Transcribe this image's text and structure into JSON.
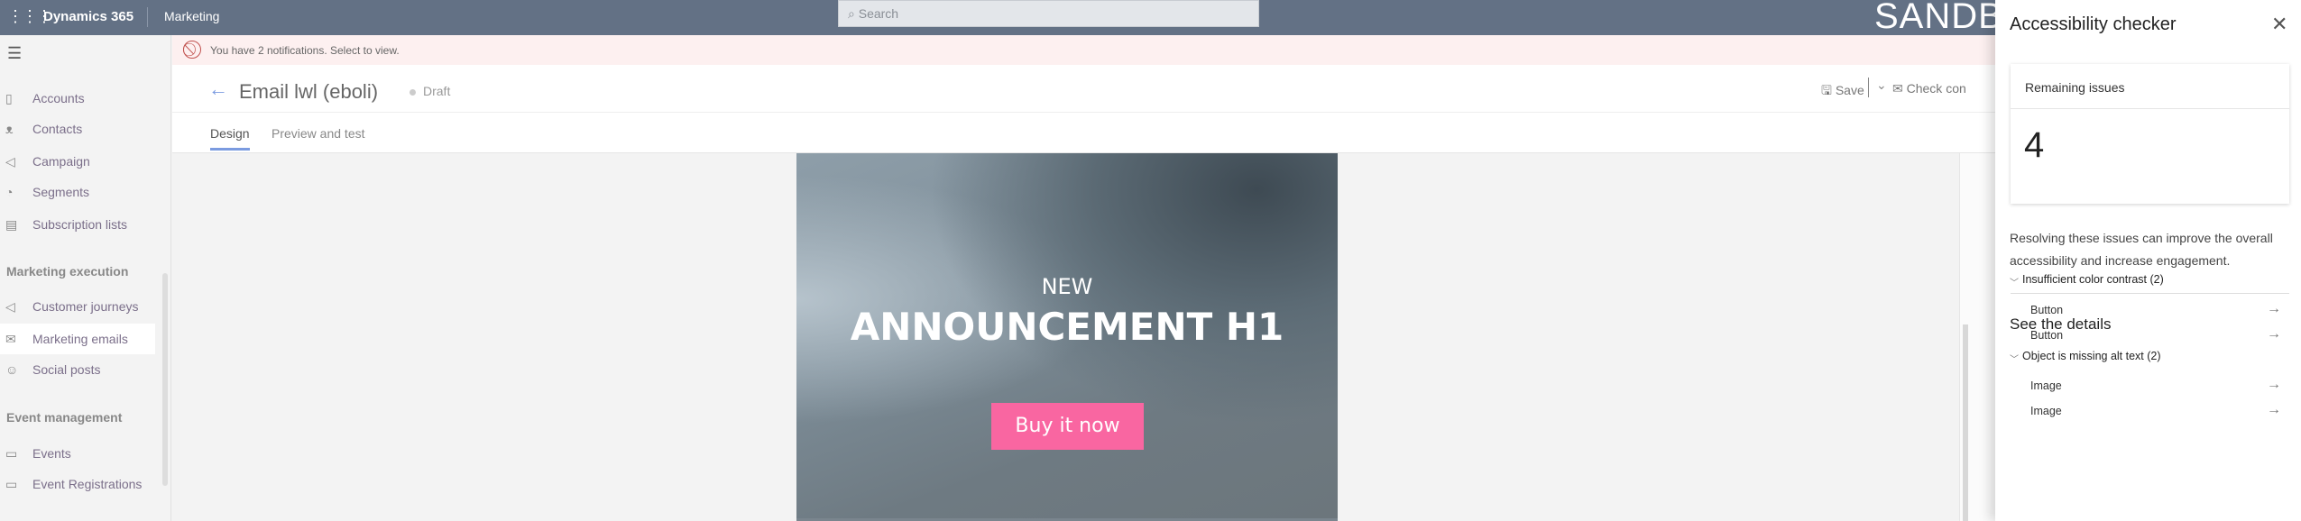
{
  "topbar": {
    "brand": "Dynamics 365",
    "app": "Marketing",
    "search_placeholder": "Search",
    "environment": "SANDBO"
  },
  "notification": {
    "text": "You have 2 notifications. Select to view."
  },
  "sidebar": {
    "items": [
      {
        "label": "Accounts",
        "icon": "accounts-icon"
      },
      {
        "label": "Contacts",
        "icon": "person-icon"
      },
      {
        "label": "Campaign",
        "icon": "megaphone-icon"
      },
      {
        "label": "Segments",
        "icon": "pie-icon"
      },
      {
        "label": "Subscription lists",
        "icon": "list-icon"
      }
    ],
    "groups": [
      {
        "title": "Marketing execution",
        "items": [
          {
            "label": "Customer journeys",
            "icon": "megaphone-icon"
          },
          {
            "label": "Marketing emails",
            "icon": "mail-icon",
            "active": true
          },
          {
            "label": "Social posts",
            "icon": "smile-icon"
          }
        ]
      },
      {
        "title": "Event management",
        "items": [
          {
            "label": "Events",
            "icon": "calendar-icon"
          },
          {
            "label": "Event Registrations",
            "icon": "calendar-icon"
          }
        ]
      }
    ]
  },
  "header": {
    "title": "Email lwl (eboli)",
    "status": "Draft",
    "save": "Save",
    "check": "Check con",
    "tabs": [
      {
        "label": "Design",
        "active": true
      },
      {
        "label": "Preview and test"
      }
    ]
  },
  "email": {
    "kicker": "NEW",
    "headline": "ANNOUNCEMENT H1",
    "button": "Buy it now",
    "button_color": "#f966a1"
  },
  "panel": {
    "title": "Accessibility checker",
    "remaining_label": "Remaining issues",
    "remaining_count": "4",
    "description": "Resolving these issues can improve the overall accessibility and increase engagement.",
    "details_title": "See the details",
    "categories": [
      {
        "label": "Insufficient color contrast (2)",
        "items": [
          "Button",
          "Button"
        ]
      },
      {
        "label": "Object is missing alt text (2)",
        "items": [
          "Image",
          "Image"
        ]
      }
    ]
  }
}
